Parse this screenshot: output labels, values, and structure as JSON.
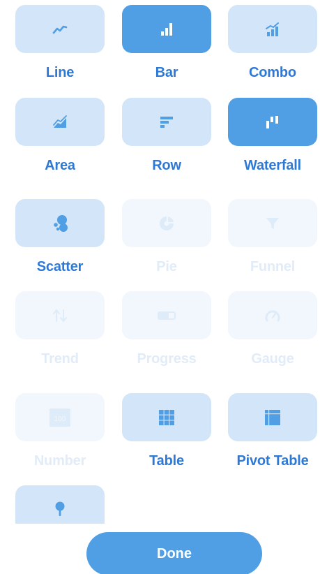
{
  "visualizations": [
    {
      "label": "Line",
      "icon": "line-chart-icon",
      "state": "normal"
    },
    {
      "label": "Bar",
      "icon": "bar-chart-icon",
      "state": "selected"
    },
    {
      "label": "Combo",
      "icon": "combo-chart-icon",
      "state": "normal"
    },
    {
      "label": "Area",
      "icon": "area-chart-icon",
      "state": "normal"
    },
    {
      "label": "Row",
      "icon": "row-chart-icon",
      "state": "normal"
    },
    {
      "label": "Waterfall",
      "icon": "waterfall-chart-icon",
      "state": "selected"
    },
    {
      "label": "Scatter",
      "icon": "scatter-chart-icon",
      "state": "normal"
    },
    {
      "label": "Pie",
      "icon": "pie-chart-icon",
      "state": "disabled"
    },
    {
      "label": "Funnel",
      "icon": "funnel-icon",
      "state": "disabled"
    },
    {
      "label": "Trend",
      "icon": "trend-arrows-icon",
      "state": "disabled"
    },
    {
      "label": "Progress",
      "icon": "progress-bar-icon",
      "state": "disabled"
    },
    {
      "label": "Gauge",
      "icon": "gauge-icon",
      "state": "disabled"
    },
    {
      "label": "Number",
      "icon": "number-icon",
      "state": "disabled",
      "icon_text": "100"
    },
    {
      "label": "Table",
      "icon": "table-grid-icon",
      "state": "normal"
    },
    {
      "label": "Pivot Table",
      "icon": "pivot-table-icon",
      "state": "normal"
    },
    {
      "label": "",
      "icon": "map-pin-icon",
      "state": "normal"
    }
  ],
  "done_button": {
    "label": "Done"
  },
  "colors": {
    "accent": "#509ee3",
    "tile_normal": "#d3e5f8",
    "tile_disabled": "#f1f7fd",
    "label": "#2f79d6",
    "label_disabled": "#e2ecf8"
  }
}
